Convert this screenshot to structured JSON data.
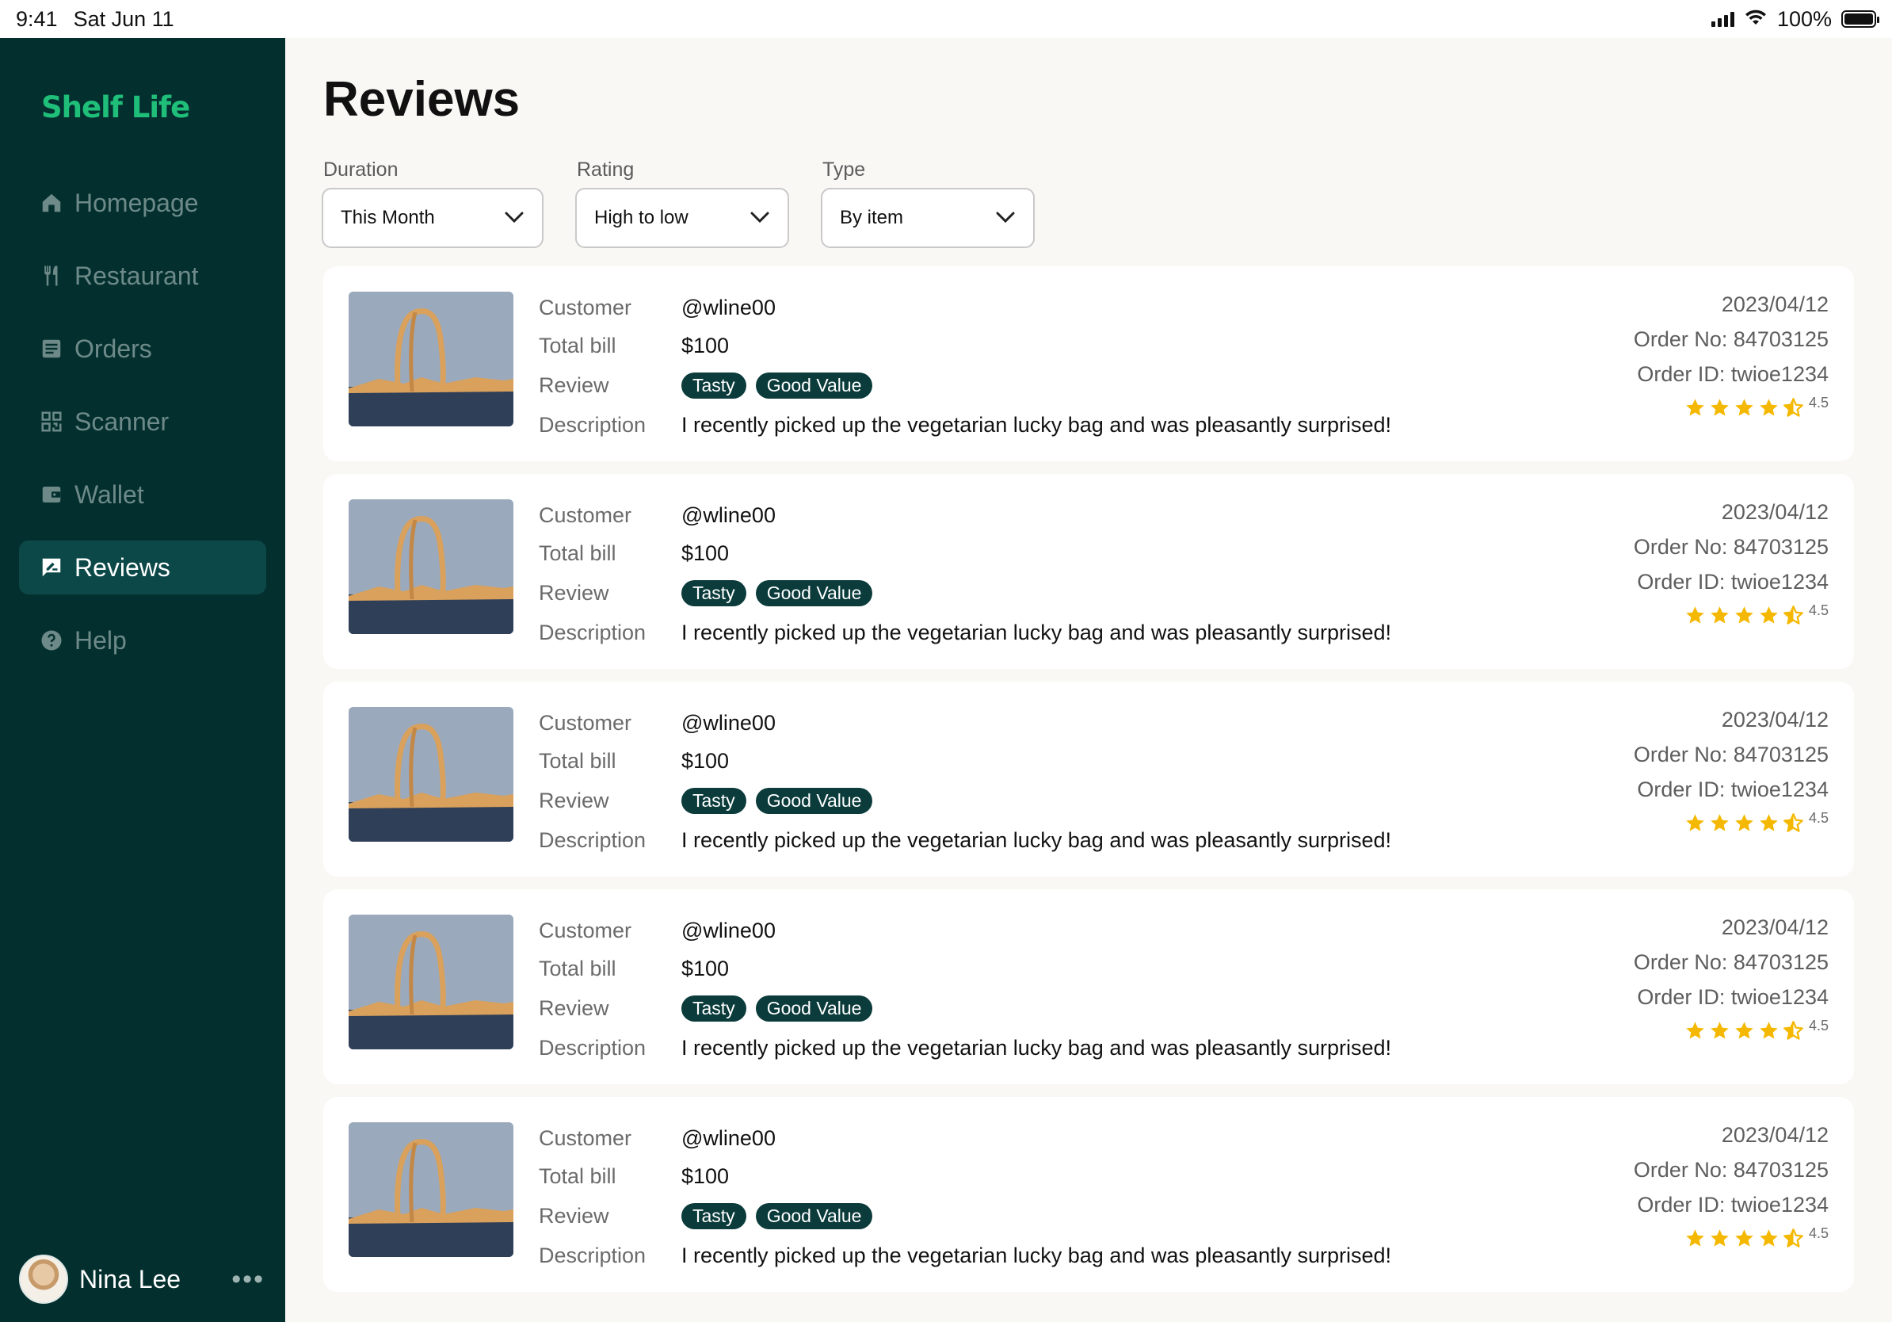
{
  "status_bar": {
    "time": "9:41",
    "date": "Sat Jun 11",
    "battery": "100%"
  },
  "sidebar": {
    "logo": "Shelf Life",
    "items": [
      {
        "label": "Homepage",
        "icon": "home-icon",
        "active": false
      },
      {
        "label": "Restaurant",
        "icon": "cutlery-icon",
        "active": false
      },
      {
        "label": "Orders",
        "icon": "orders-icon",
        "active": false
      },
      {
        "label": "Scanner",
        "icon": "scanner-icon",
        "active": false
      },
      {
        "label": "Wallet",
        "icon": "wallet-icon",
        "active": false
      },
      {
        "label": "Reviews",
        "icon": "reviews-icon",
        "active": true
      },
      {
        "label": "Help",
        "icon": "help-icon",
        "active": false
      }
    ],
    "user": {
      "name": "Nina Lee"
    }
  },
  "main": {
    "title": "Reviews",
    "filters": [
      {
        "label": "Duration",
        "value": "This Month"
      },
      {
        "label": "Rating",
        "value": "High to low"
      },
      {
        "label": "Type",
        "value": "By item"
      }
    ],
    "field_labels": {
      "customer": "Customer",
      "total_bill": "Total bill",
      "review": "Review",
      "description": "Description"
    },
    "reviews": [
      {
        "customer": "@wline00",
        "total_bill": "$100",
        "tags": [
          "Tasty",
          "Good Value"
        ],
        "description": "I recently picked up the vegetarian lucky bag and was pleasantly surprised!",
        "date": "2023/04/12",
        "order_no": "Order No: 84703125",
        "order_id": "Order ID: twioe1234",
        "rating": "4.5"
      },
      {
        "customer": "@wline00",
        "total_bill": "$100",
        "tags": [
          "Tasty",
          "Good Value"
        ],
        "description": "I recently picked up the vegetarian lucky bag and was pleasantly surprised!",
        "date": "2023/04/12",
        "order_no": "Order No: 84703125",
        "order_id": "Order ID: twioe1234",
        "rating": "4.5"
      },
      {
        "customer": "@wline00",
        "total_bill": "$100",
        "tags": [
          "Tasty",
          "Good Value"
        ],
        "description": "I recently picked up the vegetarian lucky bag and was pleasantly surprised!",
        "date": "2023/04/12",
        "order_no": "Order No: 84703125",
        "order_id": "Order ID: twioe1234",
        "rating": "4.5"
      },
      {
        "customer": "@wline00",
        "total_bill": "$100",
        "tags": [
          "Tasty",
          "Good Value"
        ],
        "description": "I recently picked up the vegetarian lucky bag and was pleasantly surprised!",
        "date": "2023/04/12",
        "order_no": "Order No: 84703125",
        "order_id": "Order ID: twioe1234",
        "rating": "4.5"
      },
      {
        "customer": "@wline00",
        "total_bill": "$100",
        "tags": [
          "Tasty",
          "Good Value"
        ],
        "description": "I recently picked up the vegetarian lucky bag and was pleasantly surprised!",
        "date": "2023/04/12",
        "order_no": "Order No: 84703125",
        "order_id": "Order ID: twioe1234",
        "rating": "4.5"
      }
    ]
  },
  "colors": {
    "sidebar_bg": "#03302f",
    "active_nav_bg": "#0d4848",
    "logo": "#1fbf7a",
    "tag_bg": "#0b3b3b",
    "star": "#f5b800",
    "page_bg": "#faf8f5"
  }
}
